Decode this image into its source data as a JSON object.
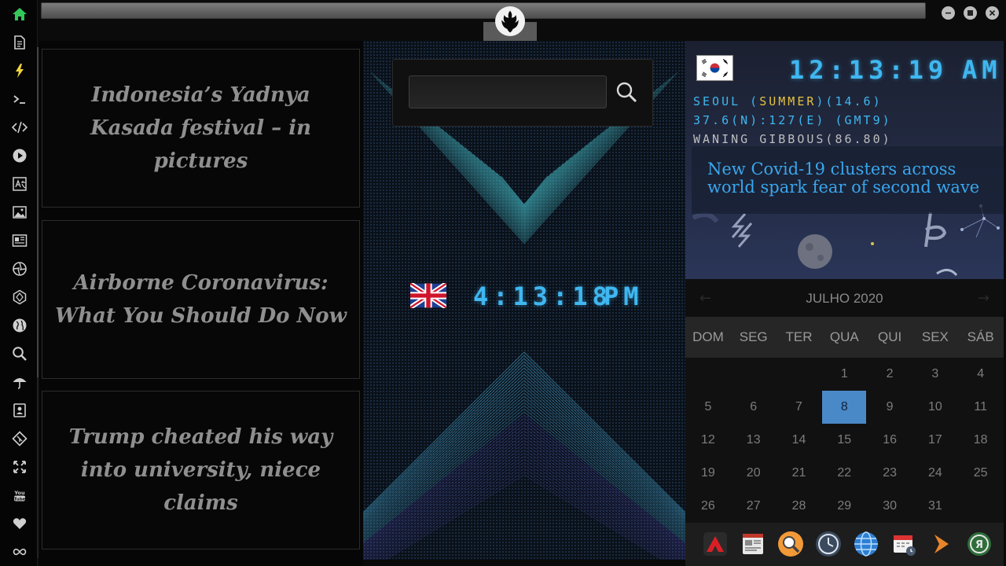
{
  "dock": {
    "items": [
      "home-icon",
      "document-icon",
      "lightning-icon",
      "terminal-icon",
      "code-icon",
      "play-icon",
      "translate-icon",
      "image-icon",
      "newspaper-icon",
      "aperture-icon",
      "hexagon-icon",
      "globe-icon",
      "search-icon",
      "umbrella-icon",
      "contacts-icon",
      "git-icon",
      "expand-icon",
      "youtube-icon",
      "heart-icon",
      "infinity-icon"
    ],
    "home_color": "#34c759"
  },
  "news": [
    {
      "title": "Indonesia’s Yadnya Kasada festival – in pictures"
    },
    {
      "title": "Airborne Coronavirus: What You Should Do Now"
    },
    {
      "title": "Trump cheated his way into university, niece claims"
    }
  ],
  "search": {
    "value": "",
    "icon": "search-icon"
  },
  "clock_uk": {
    "time": "4:13:18",
    "ampm": "PM",
    "flag": "uk-flag-icon"
  },
  "clock_kr": {
    "time": "12:13:19",
    "ampm": "AM",
    "flag": "kr-flag-icon",
    "city": "SEOUL",
    "season": "SUMMER",
    "temp": "14.6",
    "coords": "37.6(N):127(E) (GMT9)",
    "moon": "WANING GIBBOUS(86.80)"
  },
  "headline": "New Covid-19 clusters across world spark fear of second wave",
  "calendar": {
    "title": "JULHO 2020",
    "weekdays": [
      "DOM",
      "SEG",
      "TER",
      "QUA",
      "QUI",
      "SEX",
      "SÁB"
    ],
    "first_weekday_index": 3,
    "days_in_month": 31,
    "today": 8
  },
  "colors": {
    "digital": "#3fb7f0",
    "accent": "#4a89c8",
    "season": "#e3c341"
  },
  "taskbar": [
    "app-launcher-icon",
    "web-news-icon",
    "magnifier-app-icon",
    "clock-app-icon",
    "browser-globe-icon",
    "calendar-app-icon",
    "forward-arrow-icon",
    "yandex-icon"
  ]
}
